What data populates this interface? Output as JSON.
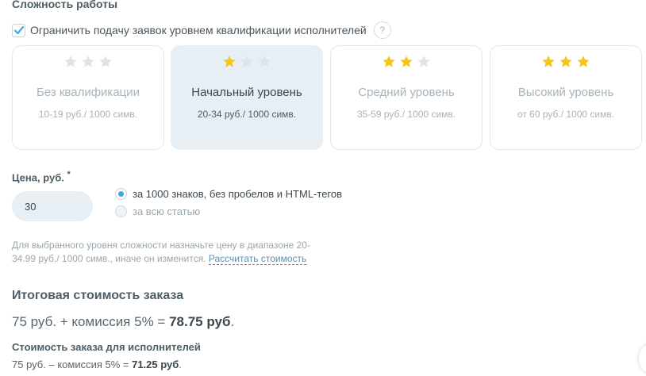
{
  "section": {
    "title": "Сложность работы"
  },
  "restrict": {
    "label": "Ограничить подачу заявок уровнем квалификации исполнителей",
    "checked": true,
    "help": "?"
  },
  "levels": [
    {
      "name": "Без квалификации",
      "price": "10-19 руб./ 1000 симв.",
      "stars_filled": 0,
      "stars_total": 3,
      "selected": false
    },
    {
      "name": "Начальный уровень",
      "price": "20-34 руб./ 1000 симв.",
      "stars_filled": 1,
      "stars_total": 3,
      "selected": true
    },
    {
      "name": "Средний уровень",
      "price": "35-59 руб./ 1000 симв.",
      "stars_filled": 2,
      "stars_total": 3,
      "selected": false
    },
    {
      "name": "Высокий уровень",
      "price": "от 60 руб./ 1000 симв.",
      "stars_filled": 3,
      "stars_total": 3,
      "selected": false
    }
  ],
  "price": {
    "label": "Цена, руб.",
    "required_mark": "*",
    "value": "30",
    "options": [
      {
        "label": "за 1000 знаков, без пробелов и HTML-тегов",
        "checked": true
      },
      {
        "label": "за всю статью",
        "checked": false
      }
    ]
  },
  "hint": {
    "text": "Для выбранного уровня сложности назначьте цену в диапазоне 20-34.99 руб./ 1000 симв., иначе он изменится.",
    "link": "Рассчитать стоимость"
  },
  "total": {
    "title": "Итоговая стоимость заказа",
    "formula": "75 руб. + комиссия 5% = ",
    "amount": "78.75 руб",
    "suffix": "."
  },
  "executor": {
    "title": "Стоимость заказа для исполнителей",
    "formula": "75 руб. – комиссия 5% = ",
    "amount": "71.25 руб",
    "suffix": "."
  },
  "colors": {
    "star_filled": "#f5c518",
    "star_empty": "#dde3e8",
    "accent": "#3da8e3",
    "selected_bg": "#e7eff5"
  }
}
